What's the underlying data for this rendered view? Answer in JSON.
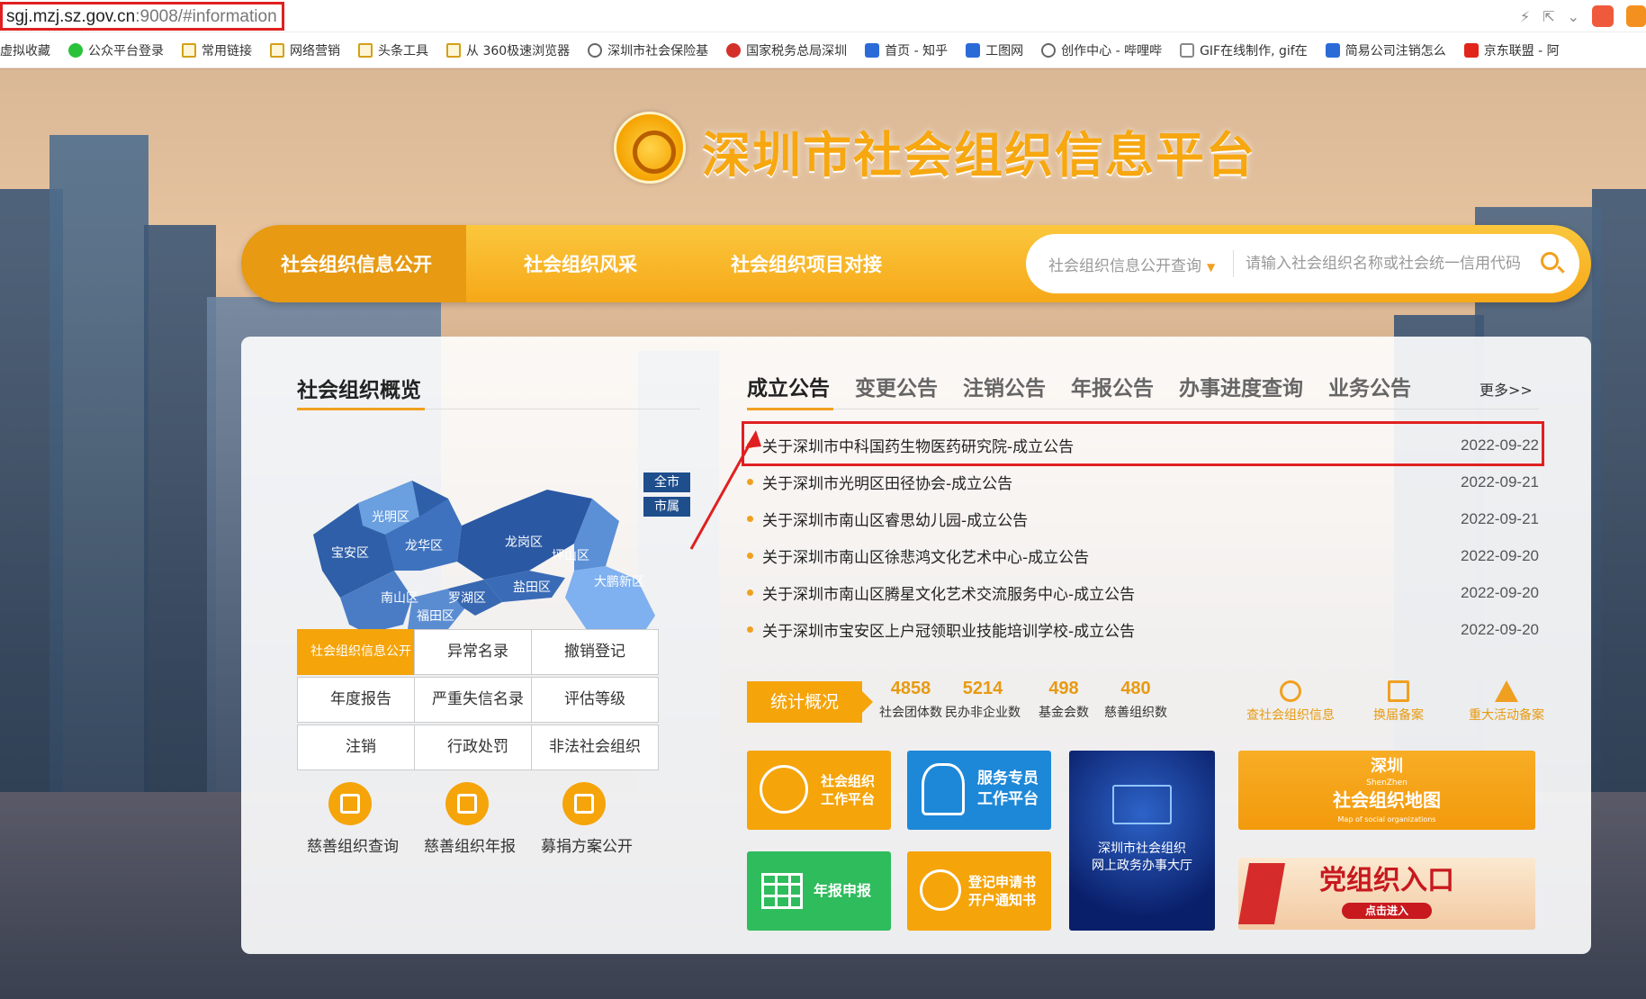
{
  "browser": {
    "url_host": "sgj.mzj.sz.gov.cn",
    "url_rest": ":9008/#information"
  },
  "bookmarks": [
    {
      "label": "虚拟收藏",
      "icon": "none"
    },
    {
      "label": "公众平台登录",
      "icon": "wechat-icon"
    },
    {
      "label": "常用链接",
      "icon": "folder-icon"
    },
    {
      "label": "网络营销",
      "icon": "folder-icon"
    },
    {
      "label": "头条工具",
      "icon": "folder-icon"
    },
    {
      "label": "从 360极速浏览器",
      "icon": "folder-icon"
    },
    {
      "label": "深圳市社会保险基",
      "icon": "globe-icon"
    },
    {
      "label": "国家税务总局深圳",
      "icon": "tax-icon"
    },
    {
      "label": "首页 - 知乎",
      "icon": "zhihu-icon"
    },
    {
      "label": "工图网",
      "icon": "case-icon"
    },
    {
      "label": "创作中心 - 哔哩哔",
      "icon": "globe-icon"
    },
    {
      "label": "GIF在线制作, gif在",
      "icon": "page-icon"
    },
    {
      "label": "简易公司注销怎么",
      "icon": "paw-icon"
    },
    {
      "label": "京东联盟 - 阿",
      "icon": "jd-icon"
    }
  ],
  "site": {
    "title": "深圳市社会组织信息平台"
  },
  "nav": {
    "items": [
      "社会组织信息公开",
      "社会组织风采",
      "社会组织项目对接"
    ],
    "search_select": "社会组织信息公开查询",
    "search_placeholder": "请输入社会组织名称或社会统一信用代码"
  },
  "overview": {
    "title": "社会组织概览",
    "districts": [
      "光明区",
      "宝安区",
      "龙华区",
      "龙岗区",
      "坪山区",
      "盐田区",
      "大鹏新区",
      "南山区",
      "罗湖区",
      "福田区"
    ],
    "btn_all": "全市",
    "btn_city": "市属"
  },
  "notice": {
    "tabs": [
      "成立公告",
      "变更公告",
      "注销公告",
      "年报公告",
      "办事进度查询",
      "业务公告"
    ],
    "more": "更多>>",
    "items": [
      {
        "title": "关于深圳市中科国药生物医药研究院-成立公告",
        "date": "2022-09-22"
      },
      {
        "title": "关于深圳市光明区田径协会-成立公告",
        "date": "2022-09-21"
      },
      {
        "title": "关于深圳市南山区睿思幼儿园-成立公告",
        "date": "2022-09-21"
      },
      {
        "title": "关于深圳市南山区徐悲鸿文化艺术中心-成立公告",
        "date": "2022-09-20"
      },
      {
        "title": "关于深圳市南山区腾星文化艺术交流服务中心-成立公告",
        "date": "2022-09-20"
      },
      {
        "title": "关于深圳市宝安区上户冠领职业技能培训学校-成立公告",
        "date": "2022-09-20"
      }
    ]
  },
  "grid": [
    "社会组织信息公开",
    "异常名录",
    "撤销登记",
    "年度报告",
    "严重失信名录",
    "评估等级",
    "注销",
    "行政处罚",
    "非法社会组织"
  ],
  "circles": [
    "慈善组织查询",
    "慈善组织年报",
    "募捐方案公开"
  ],
  "stats": {
    "tag": "统计概况",
    "items": [
      {
        "value": "4858",
        "label": "社会团体数"
      },
      {
        "value": "5214",
        "label": "民办非企业数"
      },
      {
        "value": "498",
        "label": "基金会数"
      },
      {
        "value": "480",
        "label": "慈善组织数"
      }
    ],
    "quick": [
      "查社会组织信息",
      "换届备案",
      "重大活动备案"
    ]
  },
  "tiles": {
    "work_platform": [
      "社会组织",
      "工作平台"
    ],
    "service": [
      "服务专员",
      "工作平台"
    ],
    "hall": [
      "深圳市社会组织",
      "网上政务办事大厅"
    ],
    "map": {
      "top": "深圳",
      "sub": "ShenZhen",
      "title": "社会组织地图",
      "en": "Map of social organizations"
    },
    "annual": "年报申报",
    "register": [
      "登记申请书",
      "开户通知书"
    ],
    "party": {
      "title": "党组织入口",
      "btn": "点击进入"
    }
  },
  "colors": {
    "accent": "#f5a40a",
    "nav_active": "#e79a12",
    "highlight": "#e02020"
  }
}
